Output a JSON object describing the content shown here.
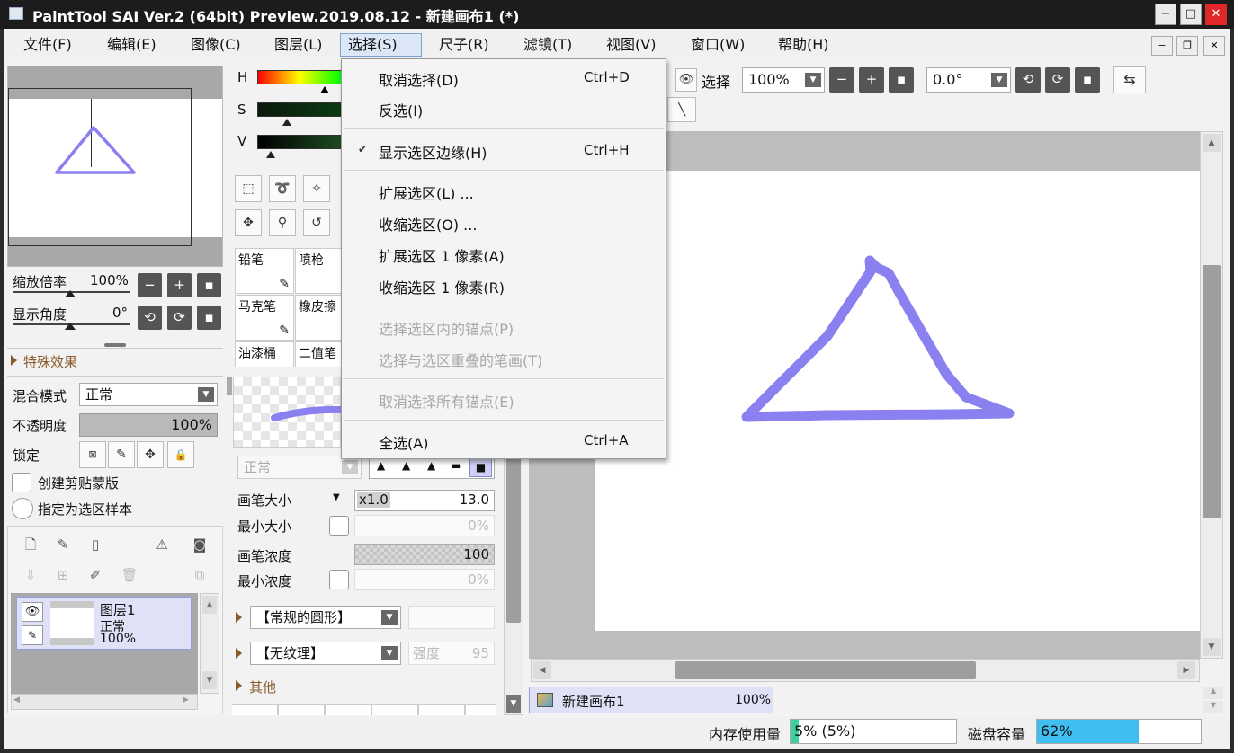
{
  "window": {
    "title": "PaintTool SAI Ver.2 (64bit) Preview.2019.08.12 - 新建画布1 (*)",
    "controls": [
      "−",
      "□",
      "✕"
    ]
  },
  "menubar": {
    "items": [
      "文件(F)",
      "编辑(E)",
      "图像(C)",
      "图层(L)",
      "选择(S)",
      "尺子(R)",
      "滤镜(T)",
      "视图(V)",
      "窗口(W)",
      "帮助(H)"
    ],
    "active_index": 4,
    "mdi_controls": [
      "−",
      "❐",
      "✕"
    ]
  },
  "select_menu": {
    "items": [
      {
        "label": "取消选择(D)",
        "shortcut": "Ctrl+D",
        "enabled": true,
        "checked": false
      },
      {
        "label": "反选(I)",
        "shortcut": "",
        "enabled": true,
        "checked": false
      },
      {
        "label": "显示选区边缘(H)",
        "shortcut": "Ctrl+H",
        "enabled": true,
        "checked": true
      },
      {
        "label": "扩展选区(L) ...",
        "shortcut": "",
        "enabled": true,
        "checked": false
      },
      {
        "label": "收缩选区(O) ...",
        "shortcut": "",
        "enabled": true,
        "checked": false
      },
      {
        "label": "扩展选区 1 像素(A)",
        "shortcut": "",
        "enabled": true,
        "checked": false
      },
      {
        "label": "收缩选区 1 像素(R)",
        "shortcut": "",
        "enabled": true,
        "checked": false
      },
      {
        "label": "选择选区内的锚点(P)",
        "shortcut": "",
        "enabled": false,
        "checked": false
      },
      {
        "label": "选择与选区重叠的笔画(T)",
        "shortcut": "",
        "enabled": false,
        "checked": false
      },
      {
        "label": "取消选择所有锚点(E)",
        "shortcut": "",
        "enabled": false,
        "checked": false
      },
      {
        "label": "全选(A)",
        "shortcut": "Ctrl+A",
        "enabled": true,
        "checked": false
      }
    ]
  },
  "navigator": {
    "zoom_label": "缩放倍率",
    "zoom_value": "100%",
    "angle_label": "显示角度",
    "angle_value": "0°"
  },
  "special_effects": {
    "label": "特殊效果"
  },
  "layer_props": {
    "blend_label": "混合模式",
    "blend_value": "正常",
    "opacity_label": "不透明度",
    "opacity_value": "100%",
    "lock_label": "锁定",
    "clip_label": "创建剪贴蒙版",
    "sample_label": "指定为选区样本"
  },
  "layers": [
    {
      "name": "图层1",
      "mode": "正常",
      "opacity": "100%"
    }
  ],
  "color": {
    "h_label": "H",
    "s_label": "S",
    "v_label": "V"
  },
  "brushes": [
    "铅笔",
    "喷枪",
    "马克笔",
    "橡皮擦",
    "油漆桶",
    "二值笔"
  ],
  "brush_settings": {
    "mode_value": "正常",
    "size_label": "画笔大小",
    "size_multiplier": "x1.0",
    "size_value": "13.0",
    "min_size_label": "最小大小",
    "min_size_value": "0%",
    "density_label": "画笔浓度",
    "density_value": "100",
    "min_density_label": "最小浓度",
    "min_density_value": "0%",
    "shape_value": "【常规的圆形】",
    "texture_value": "【无纹理】",
    "strength_label": "强度",
    "strength_value": "95",
    "other_label": "其他"
  },
  "view_toolbar": {
    "select_label": "选择",
    "zoom_value": "100%",
    "rotation_value": "0.0°"
  },
  "document_tab": {
    "name": "新建画布1",
    "zoom": "100%"
  },
  "status": {
    "memory_label": "内存使用量",
    "memory_value": "5% (5%)",
    "memory_fraction": 0.05,
    "disk_label": "磁盘容量",
    "disk_value": "62%",
    "disk_fraction": 0.62
  },
  "colors": {
    "stroke": "#8a80f0",
    "selection_highlight": "#dbe6f7",
    "disk_fill": "#3fbef0",
    "memory_fill": "#3fd0a0"
  }
}
